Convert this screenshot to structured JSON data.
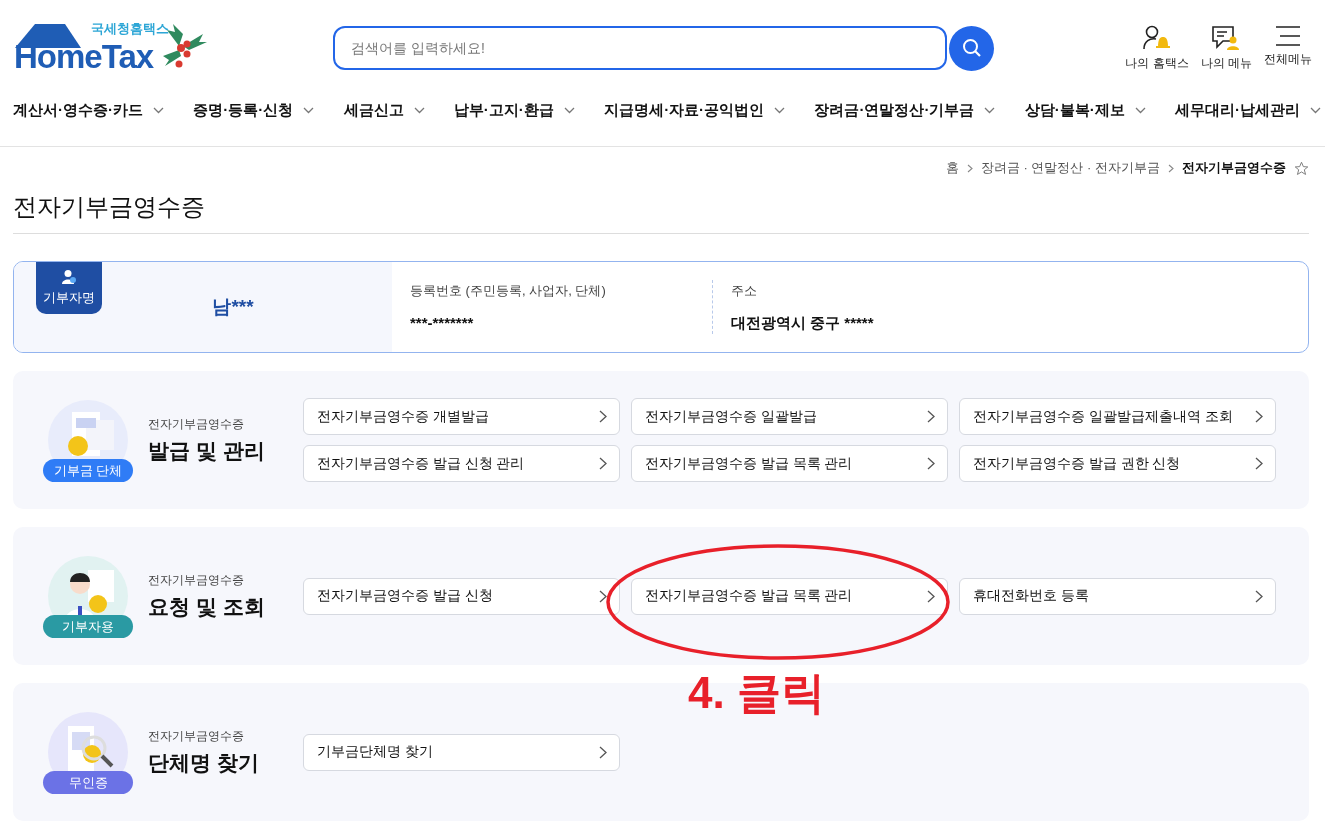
{
  "logo": {
    "subtitle": "국세청홈택스",
    "title": "HomeTax"
  },
  "search": {
    "placeholder": "검색어를 입력하세요!"
  },
  "utility_menu": [
    {
      "label": "나의 홈택스",
      "kind": "user"
    },
    {
      "label": "나의 메뉴",
      "kind": "menu"
    },
    {
      "label": "전체메뉴",
      "kind": "all"
    }
  ],
  "nav": [
    "계산서·영수증·카드",
    "증명·등록·신청",
    "세금신고",
    "납부·고지·환급",
    "지급명세·자료·공익법인",
    "장려금·연말정산·기부금",
    "상담·불복·제보",
    "세무대리·납세관리"
  ],
  "breadcrumb": [
    {
      "label": "홈",
      "current": false
    },
    {
      "label": "장려금 · 연말정산 · 전자기부금",
      "current": false
    },
    {
      "label": "전자기부금영수증",
      "current": true
    }
  ],
  "page_title": "전자기부금영수증",
  "donor": {
    "badge": "기부자명",
    "name": "남***",
    "reg_label": "등록번호 (주민등록, 사업자, 단체)",
    "reg_value": "***-*******",
    "addr_label": "주소",
    "addr_value": "대전광역시 중구 *****"
  },
  "sections": [
    {
      "kind": "org",
      "badge": "기부금 단체",
      "color": "#2f7cf6",
      "subtitle": "전자기부금영수증",
      "title": "발급 및 관리",
      "links": [
        "전자기부금영수증 개별발급",
        "전자기부금영수증 일괄발급",
        "전자기부금영수증 일괄발급제출내역 조회",
        "전자기부금영수증 발급 신청 관리",
        "전자기부금영수증 발급 목록 관리",
        "전자기부금영수증 발급 권한 신청"
      ]
    },
    {
      "kind": "donor",
      "badge": "기부자용",
      "color": "#2a9aa3",
      "subtitle": "전자기부금영수증",
      "title": "요청 및 조회",
      "links": [
        "전자기부금영수증 발급 신청",
        "전자기부금영수증 발급 목록 관리",
        "휴대전화번호 등록"
      ]
    },
    {
      "kind": "search",
      "badge": "무인증",
      "color": "#6b72e6",
      "subtitle": "전자기부금영수증",
      "title": "단체명 찾기",
      "links": [
        "기부금단체명 찾기"
      ]
    }
  ],
  "annotation": {
    "text": "4. 클릭"
  }
}
